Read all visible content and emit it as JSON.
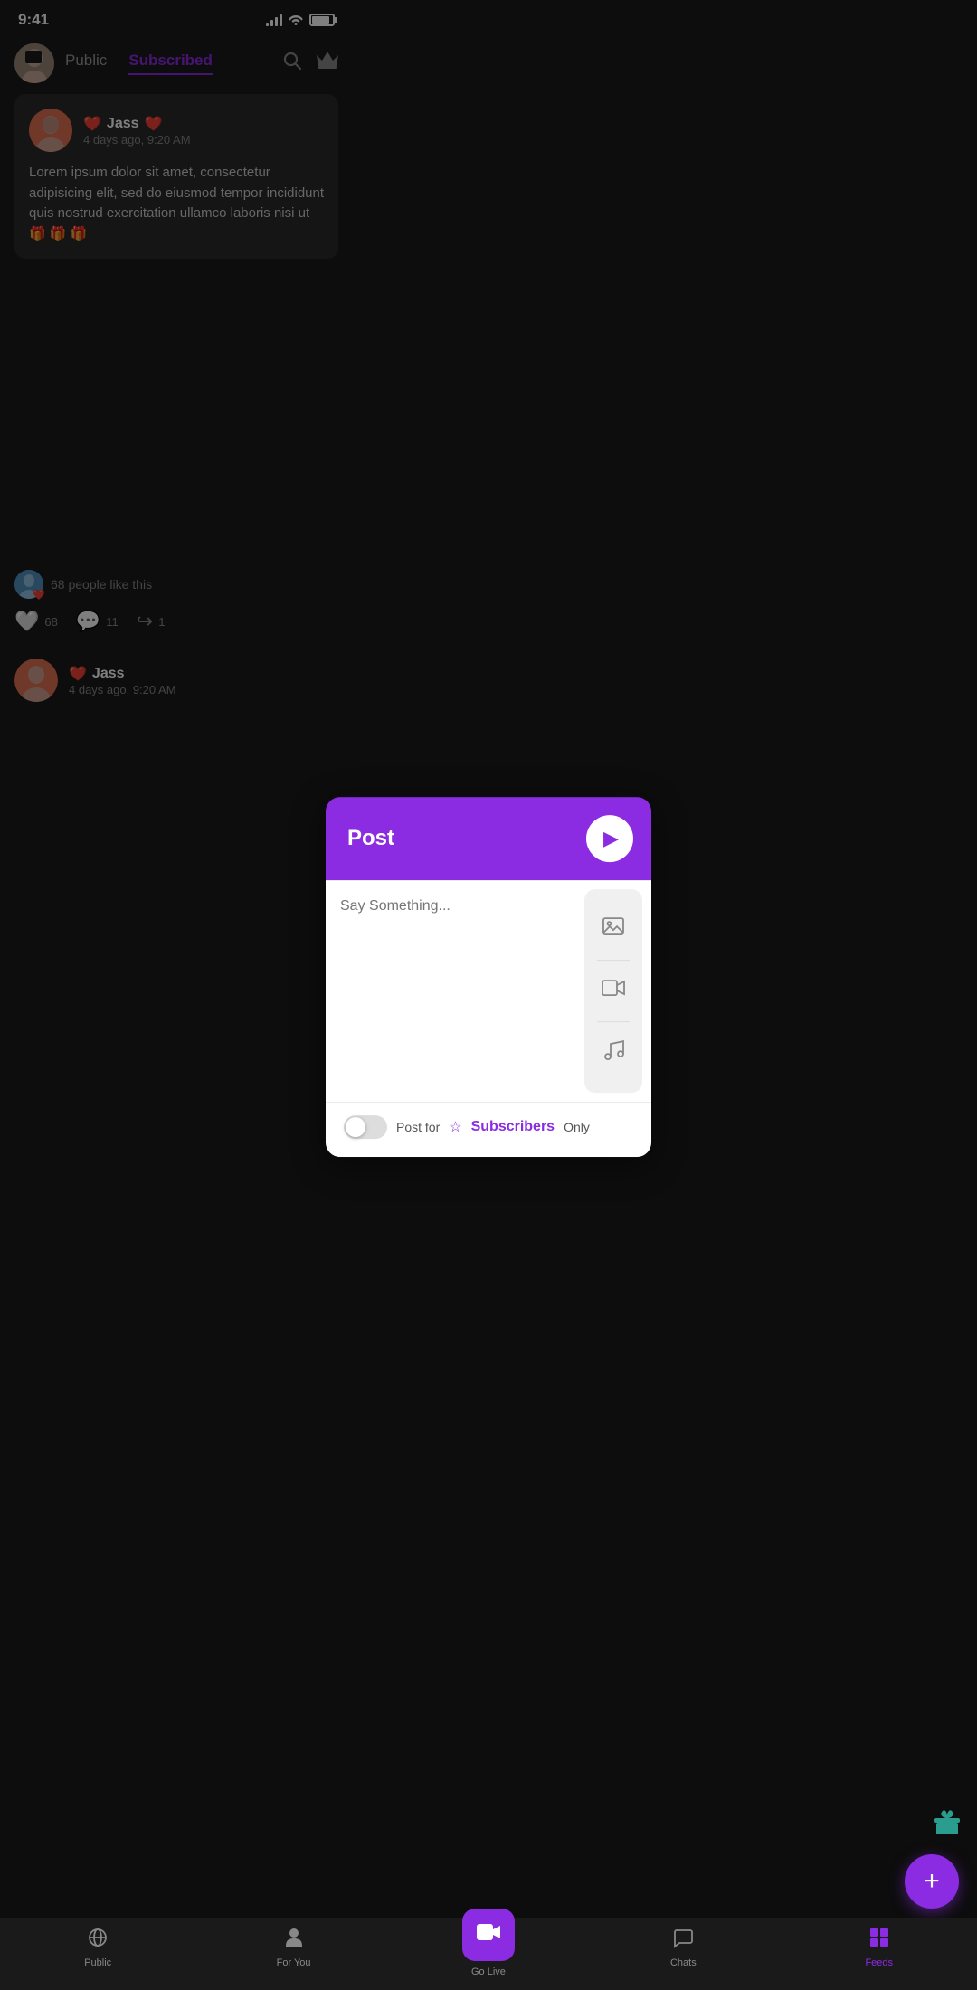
{
  "statusBar": {
    "time": "9:41"
  },
  "header": {
    "tabs": [
      "Public",
      "Subscribed"
    ],
    "activeTab": "Subscribed"
  },
  "feedPost": {
    "author": "Jass",
    "heartEmoji": "❤️",
    "timestamp": "4 days ago, 9:20 AM",
    "content": "Lorem ipsum dolor sit amet, consectetur adipisicing elit, sed do eiusmod tempor incididunt  quis nostrud exercitation ullamco laboris nisi ut 🎁 🎁 🎁",
    "likesCount": "68",
    "commentsCount": "11",
    "sharesCount": "1",
    "likesText": "68 people like this"
  },
  "postModal": {
    "title": "Post",
    "placeholder": "Say Something...",
    "postForText": "Post for",
    "subscribersText": "Subscribers",
    "onlyText": "Only",
    "sendLabel": "send"
  },
  "sideActions": {
    "imageLabel": "image-upload",
    "videoLabel": "video-upload",
    "musicLabel": "music-upload"
  },
  "bottomNav": {
    "items": [
      {
        "id": "public",
        "label": "Public",
        "icon": "◎",
        "active": false
      },
      {
        "id": "foryou",
        "label": "For You",
        "icon": "👤",
        "active": false
      },
      {
        "id": "golive",
        "label": "Go Live",
        "icon": "🎬",
        "active": false
      },
      {
        "id": "chats",
        "label": "Chats",
        "icon": "💬",
        "active": false
      },
      {
        "id": "feeds",
        "label": "Feeds",
        "icon": "📋",
        "active": true
      }
    ]
  },
  "colors": {
    "accent": "#8B2BE2",
    "giftTeal": "#2a9d8f"
  }
}
